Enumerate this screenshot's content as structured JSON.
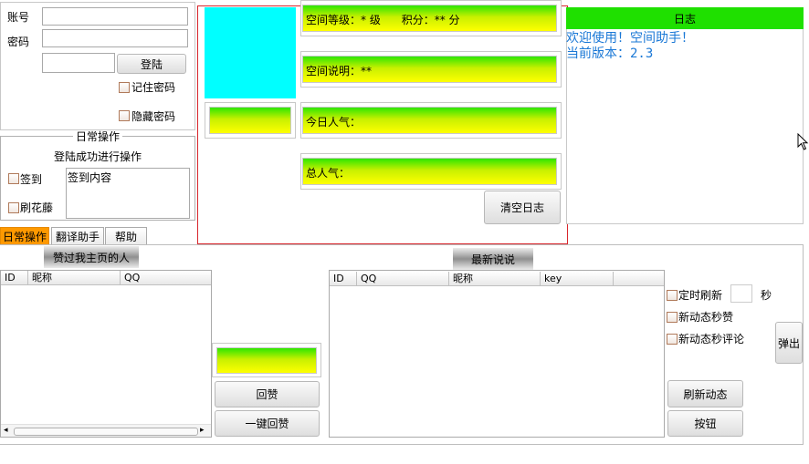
{
  "login": {
    "account_label": "账号",
    "password_label": "密码",
    "login_button": "登陆",
    "remember_password": "记住密码",
    "hide_password": "隐藏密码"
  },
  "daily": {
    "group_title": "日常操作",
    "hint": "登陆成功进行操作",
    "signin_label": "签到",
    "flower_label": "刷花藤",
    "signin_content": "签到内容"
  },
  "space": {
    "level_text": "空间等级：* 级      积分：** 分",
    "desc_text": "空间说明：**",
    "today_visits": "今日人气：",
    "total_visits": "总人气：",
    "clear_log_button": "清空日志",
    "accent_red": "#d9262c",
    "avatar_color": "#00ffff"
  },
  "log": {
    "title": "日志",
    "lines": [
      "欢迎使用！空间助手！",
      "当前版本：2.3"
    ],
    "text_color": "#1a78d6",
    "header_color": "#1fe000"
  },
  "tabs": [
    {
      "label": "日常操作",
      "active": true
    },
    {
      "label": "翻译助手",
      "active": false
    },
    {
      "label": "帮助",
      "active": false
    }
  ],
  "likers": {
    "title": "赞过我主页的人",
    "columns": [
      "ID",
      "昵称",
      "QQ"
    ]
  },
  "actions": {
    "reply_like_button": "回赞",
    "one_key_reply_button": "一键回赞"
  },
  "feeds": {
    "title": "最新说说",
    "columns": [
      "ID",
      "QQ",
      "昵称",
      "key"
    ]
  },
  "auto": {
    "timed_refresh": "定时刷新",
    "seconds_unit": "秒",
    "instant_like": "新动态秒赞",
    "instant_comment": "新动态秒评论",
    "popup_button": "弹出",
    "refresh_button": "刷新动态",
    "generic_button": "按钮"
  }
}
